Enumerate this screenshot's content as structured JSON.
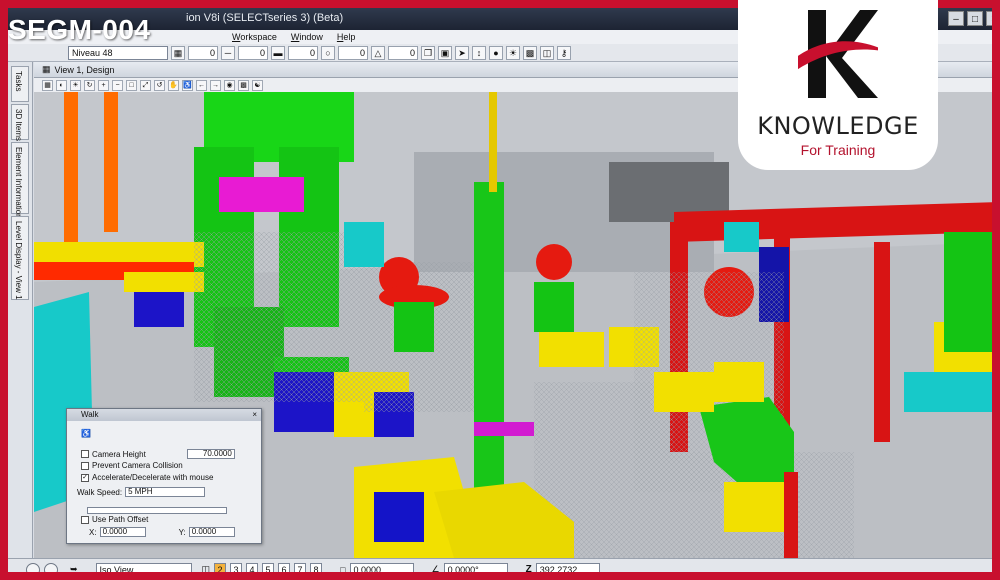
{
  "badge": "SEGM-004",
  "logo": {
    "name": "KNOWLEDGE",
    "tagline": "For Training",
    "red": "#c8102e"
  },
  "titlebar": {
    "title": "ion V8i (SELECTseries 3) (Beta)"
  },
  "menu": [
    {
      "mn": "W",
      "rest": "orkspace"
    },
    {
      "mn": "W",
      "rest": "indow"
    },
    {
      "mn": "H",
      "rest": "elp"
    }
  ],
  "toolbar": {
    "level": "Niveau 48",
    "values": [
      "0",
      "0",
      "0",
      "0",
      "0"
    ]
  },
  "side_tabs": [
    "Tasks",
    "3D Items",
    "Element Information",
    "Level Display - View 1"
  ],
  "view": {
    "title": "View 1, Design"
  },
  "walk_dialog": {
    "title": "Walk",
    "camera_height_label": "Camera Height",
    "camera_height_value": "70.0000",
    "camera_height_checked": false,
    "prevent_collision_label": "Prevent Camera Collision",
    "prevent_collision_checked": false,
    "accelerate_label": "Accelerate/Decelerate with mouse",
    "accelerate_checked": true,
    "walk_speed_label": "Walk Speed:",
    "walk_speed_value": "5 MPH",
    "path_offset_label": "Use Path Offset",
    "path_offset_checked": false,
    "x_label": "X:",
    "x_value": "0.0000",
    "y_label": "Y:",
    "y_value": "0.0000"
  },
  "statusbar": {
    "view_mode": "Iso View",
    "view_numbers": [
      "2",
      "3",
      "4",
      "5",
      "6",
      "7",
      "8"
    ],
    "active_view": "2",
    "field1": "0.0000",
    "field2": "0.0000°",
    "z_label": "Z",
    "z_value": "392.2732"
  }
}
